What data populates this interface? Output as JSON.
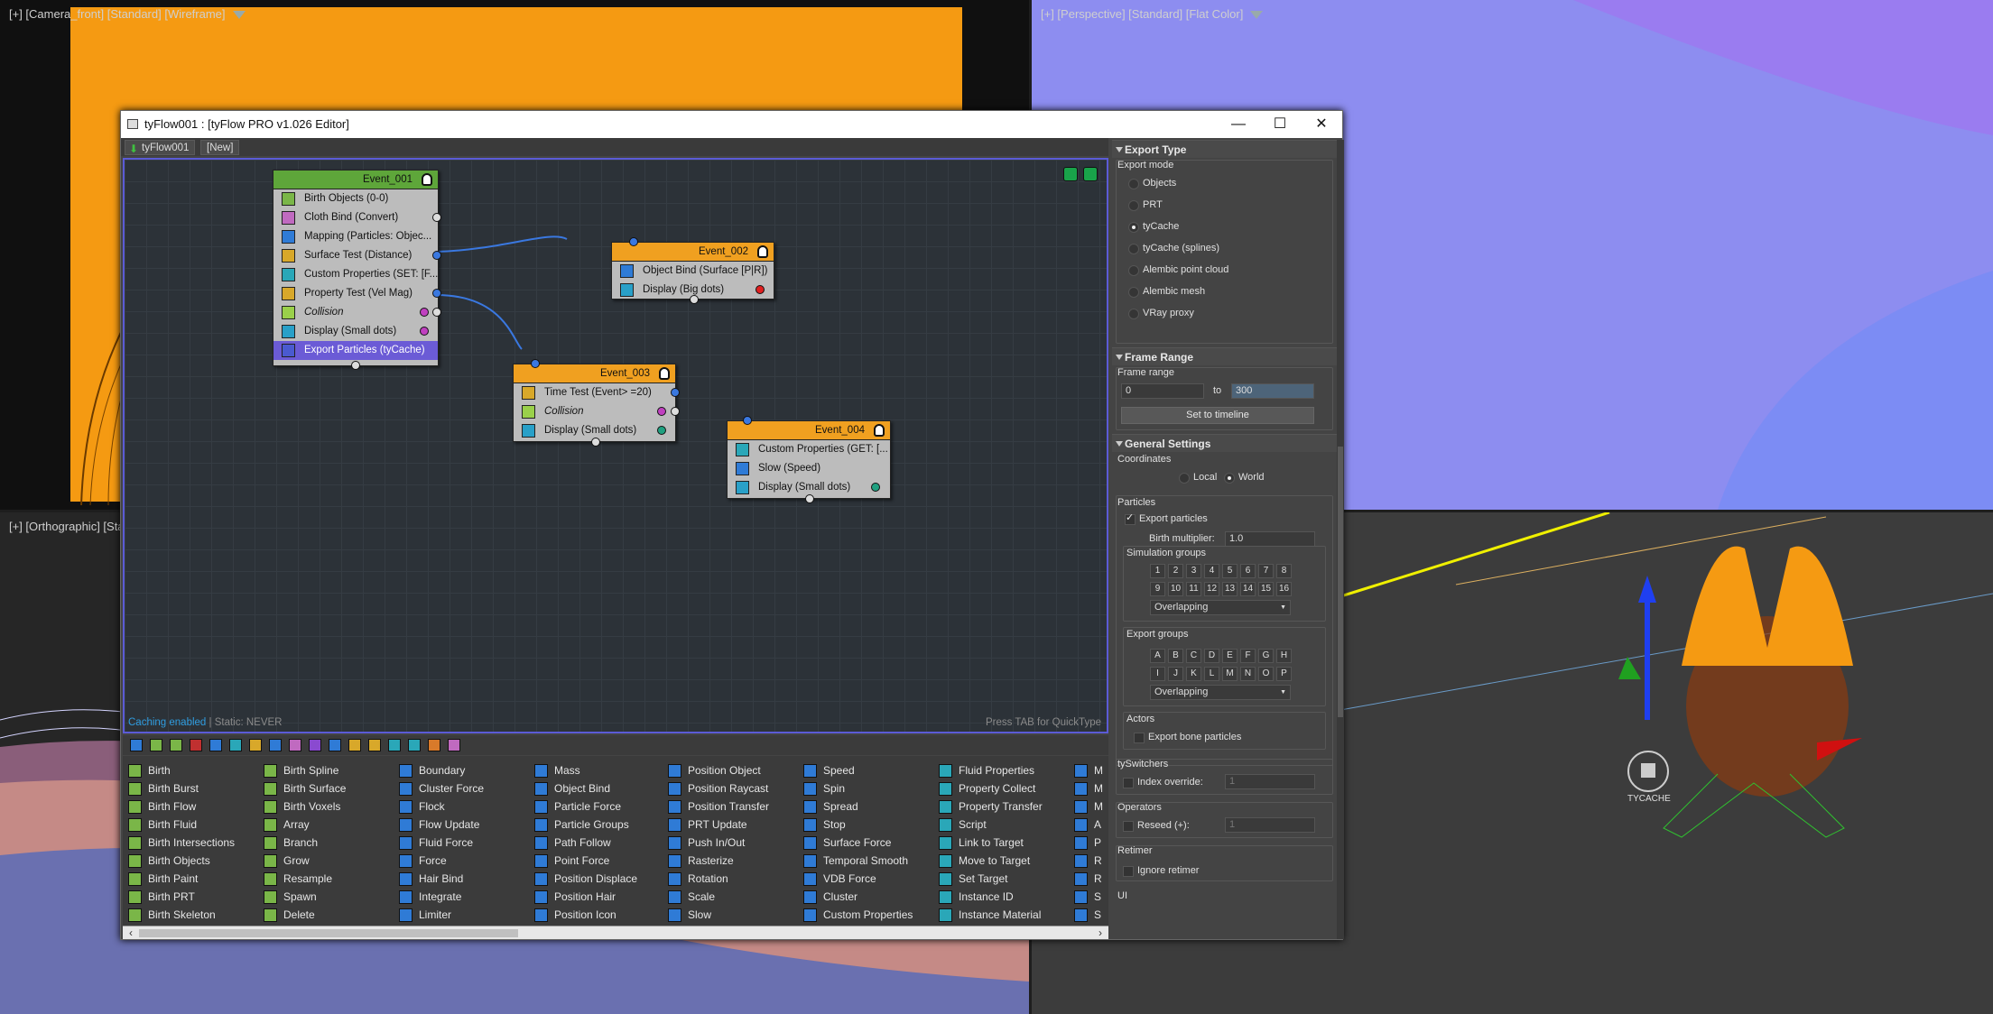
{
  "viewports": {
    "camera": {
      "label": "[+] [Camera_front] [Standard] [Wireframe]"
    },
    "perspective": {
      "label": "[+] [Perspective] [Standard] [Flat Color]"
    },
    "ortho": {
      "label": "[+] [Orthographic] [Sta"
    },
    "gizmo_label": "TYCACHE"
  },
  "editor": {
    "title": "tyFlow001 : [tyFlow PRO v1.026 Editor]",
    "tabs": [
      "tyFlow001",
      "[New]"
    ],
    "status_caching": "Caching enabled",
    "status_static": " | Static: NEVER",
    "tab_hint": "Press TAB for QuickType",
    "window_buttons": [
      "—",
      "☐",
      "✕"
    ]
  },
  "nodes": [
    {
      "title": "Event_001",
      "color": "#5ea63a",
      "rows": [
        {
          "label": "Birth Objects (0-0)",
          "icon_color": "#7ab648"
        },
        {
          "label": "Cloth Bind (Convert)",
          "icon_color": "#c06ac0"
        },
        {
          "label": "Mapping (Particles: Objec...",
          "icon_color": "#2f7bd6"
        },
        {
          "label": "Surface Test (Distance)",
          "icon_color": "#d8a82a"
        },
        {
          "label": "Custom Properties (SET: [F...",
          "icon_color": "#2aa7b8"
        },
        {
          "label": "Property Test (Vel Mag)",
          "icon_color": "#d8a82a"
        },
        {
          "label": "Collision",
          "icon_color": "#9ad04a",
          "italic": true
        },
        {
          "label": "Display (Small dots)",
          "icon_color": "#29a0c8"
        },
        {
          "label": "Export Particles (tyCache)",
          "icon_color": "#4a5ad0",
          "selected": true
        }
      ]
    },
    {
      "title": "Event_002",
      "color": "#f0a020",
      "rows": [
        {
          "label": "Object Bind (Surface [P|R])",
          "icon_color": "#2f7bd6"
        },
        {
          "label": "Display (Big dots)",
          "icon_color": "#29a0c8"
        }
      ]
    },
    {
      "title": "Event_003",
      "color": "#f0a020",
      "rows": [
        {
          "label": "Time Test (Event> =20)",
          "icon_color": "#d8a82a"
        },
        {
          "label": "Collision",
          "icon_color": "#9ad04a",
          "italic": true
        },
        {
          "label": "Display (Small dots)",
          "icon_color": "#29a0c8"
        }
      ]
    },
    {
      "title": "Event_004",
      "color": "#f0a020",
      "rows": [
        {
          "label": "Custom Properties (GET: [...",
          "icon_color": "#2aa7b8"
        },
        {
          "label": "Slow (Speed)",
          "icon_color": "#2f7bd6"
        },
        {
          "label": "Display (Small dots)",
          "icon_color": "#29a0c8"
        }
      ]
    }
  ],
  "operators": [
    {
      "items": [
        "Birth",
        "Birth Burst",
        "Birth Flow",
        "Birth Fluid",
        "Birth Intersections",
        "Birth Objects",
        "Birth Paint",
        "Birth PRT",
        "Birth Skeleton"
      ],
      "icon_color": "#7ab648"
    },
    {
      "items": [
        "Birth Spline",
        "Birth Surface",
        "Birth Voxels",
        "Array",
        "Branch",
        "Grow",
        "Resample",
        "Spawn",
        "Delete"
      ],
      "icon_color": "#7ab648"
    },
    {
      "items": [
        "Boundary",
        "Cluster Force",
        "Flock",
        "Flow Update",
        "Fluid Force",
        "Force",
        "Hair Bind",
        "Integrate",
        "Limiter"
      ],
      "icon_color": "#2f7bd6"
    },
    {
      "items": [
        "Mass",
        "Object Bind",
        "Particle Force",
        "Particle Groups",
        "Path Follow",
        "Point Force",
        "Position Displace",
        "Position Hair",
        "Position Icon"
      ],
      "icon_color": "#2f7bd6"
    },
    {
      "items": [
        "Position Object",
        "Position Raycast",
        "Position Transfer",
        "PRT Update",
        "Push In/Out",
        "Rasterize",
        "Rotation",
        "Scale",
        "Slow"
      ],
      "icon_color": "#2f7bd6"
    },
    {
      "items": [
        "Speed",
        "Spin",
        "Spread",
        "Stop",
        "Surface Force",
        "Temporal Smooth",
        "VDB Force",
        "Cluster",
        "Custom Properties"
      ],
      "icon_color": "#2f7bd6"
    },
    {
      "items": [
        "Fluid Properties",
        "Property Collect",
        "Property Transfer",
        "Script",
        "Link to Target",
        "Move to Target",
        "Set Target",
        "Instance ID",
        "Instance Material"
      ],
      "icon_color": "#2aa7b8"
    },
    {
      "items": [
        "M",
        "M",
        "M",
        "A",
        "P",
        "R",
        "R",
        "S",
        "S"
      ],
      "icon_color": "#2f7bd6"
    }
  ],
  "panel": {
    "export_type": {
      "title": "Export Type",
      "mode_label": "Export mode",
      "options": [
        "Objects",
        "PRT",
        "tyCache",
        "tyCache (splines)",
        "Alembic point cloud",
        "Alembic mesh",
        "VRay proxy"
      ],
      "selected": "tyCache"
    },
    "frame_range": {
      "title": "Frame Range",
      "label": "Frame range",
      "from": "0",
      "to_label": "to",
      "to": "300",
      "button": "Set to timeline"
    },
    "general": {
      "title": "General Settings",
      "coordinates_label": "Coordinates",
      "local": "Local",
      "world": "World",
      "particles_label": "Particles",
      "export_particles": "Export particles",
      "birth_mult_label": "Birth multiplier:",
      "birth_mult": "1.0",
      "sim_groups_label": "Simulation groups",
      "sim_groups": [
        "1",
        "2",
        "3",
        "4",
        "5",
        "6",
        "7",
        "8",
        "9",
        "10",
        "11",
        "12",
        "13",
        "14",
        "15",
        "16"
      ],
      "sim_mode": "Overlapping",
      "export_groups_label": "Export groups",
      "export_groups": [
        "A",
        "B",
        "C",
        "D",
        "E",
        "F",
        "G",
        "H",
        "I",
        "J",
        "K",
        "L",
        "M",
        "N",
        "O",
        "P"
      ],
      "export_mode": "Overlapping",
      "actors_label": "Actors",
      "export_bones": "Export bone particles",
      "tyswitchers_label": "tySwitchers",
      "index_override": "Index override:",
      "index_value": "1",
      "operators_label": "Operators",
      "reseed": "Reseed (+):",
      "reseed_value": "1",
      "retimer_label": "Retimer",
      "ignore_retimer": "Ignore retimer",
      "ui_label": "UI"
    }
  }
}
